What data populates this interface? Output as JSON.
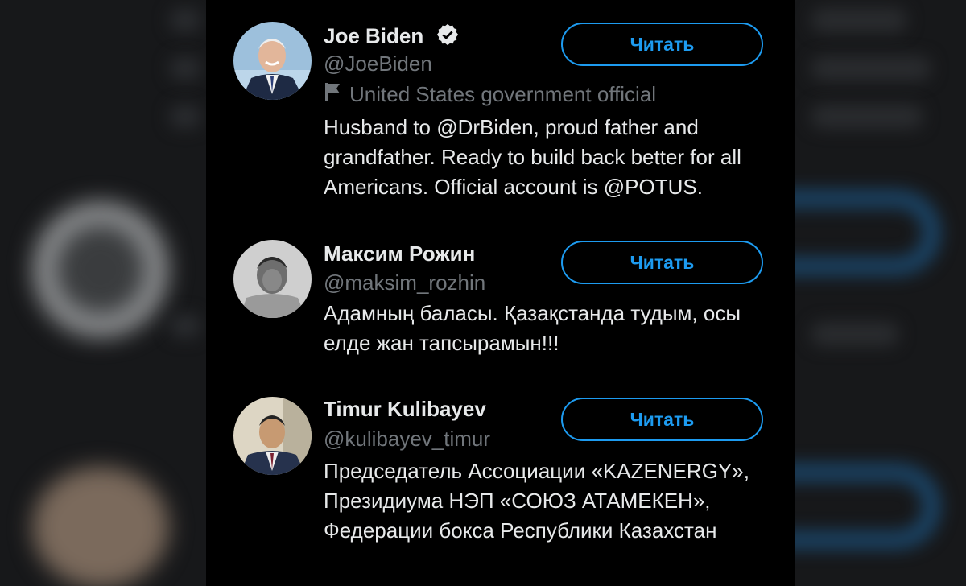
{
  "accounts": [
    {
      "name": "Joe Biden",
      "handle": "@JoeBiden",
      "label": "United States government official",
      "bio": "Husband to @DrBiden, proud father and grandfather. Ready to build back better for all Americans. Official account is @POTUS.",
      "follow_label": "Читать"
    },
    {
      "name": "Максим Рожин",
      "handle": "@maksim_rozhin",
      "bio": "Адамның баласы. Қазақстанда тудым, осы елде жан тапсырамын!!!",
      "follow_label": "Читать"
    },
    {
      "name": "Timur Kulibayev",
      "handle": "@kulibayev_timur",
      "bio": "Председатель Ассоциации «KAZENERGY», Президиума НЭП «СОЮЗ АТАМЕКЕН», Федерации бокса Республики Казахстан",
      "follow_label": "Читать"
    }
  ],
  "colors": {
    "accent": "#1d9bf0",
    "text": "#e7e9ea",
    "muted": "#71767b",
    "background": "#000000"
  }
}
